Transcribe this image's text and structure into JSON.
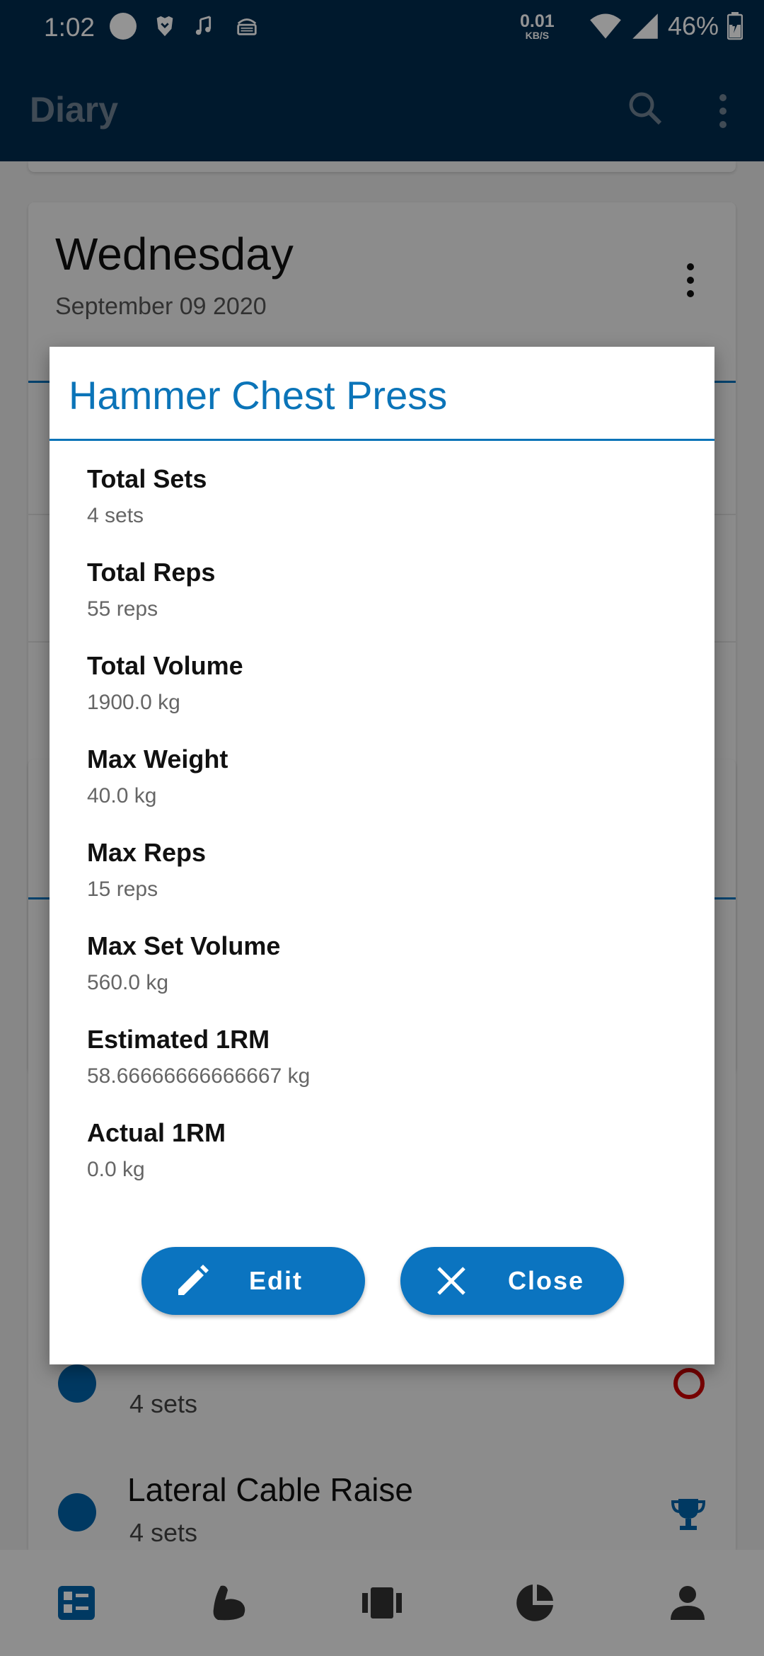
{
  "status_bar": {
    "time": "1:02",
    "net_speed": "0.01",
    "net_unit": "KB/S",
    "battery": "46%"
  },
  "app_bar": {
    "title": "Diary"
  },
  "background": {
    "day_name": "Wednesday",
    "day_date": "September 09 2020",
    "items": [
      {
        "name": "",
        "sets": "4 sets"
      },
      {
        "name": "Lateral Cable Raise",
        "sets": "4 sets"
      }
    ]
  },
  "dialog": {
    "title": "Hammer Chest Press",
    "stats": [
      {
        "label": "Total Sets",
        "value": "4 sets"
      },
      {
        "label": "Total Reps",
        "value": "55 reps"
      },
      {
        "label": "Total Volume",
        "value": "1900.0 kg"
      },
      {
        "label": "Max Weight",
        "value": "40.0 kg"
      },
      {
        "label": "Max Reps",
        "value": "15 reps"
      },
      {
        "label": "Max Set Volume",
        "value": "560.0 kg"
      },
      {
        "label": "Estimated 1RM",
        "value": "58.66666666666667 kg"
      },
      {
        "label": "Actual 1RM",
        "value": "0.0 kg"
      }
    ],
    "edit_label": "Edit",
    "close_label": "Close"
  },
  "colors": {
    "primary_dark": "#002b4e",
    "accent": "#0b74c0",
    "title_blue": "#0b74b8"
  },
  "icons": {
    "app_bar": [
      "search-icon",
      "more-vert-icon"
    ],
    "bottom_nav": [
      "diary-icon",
      "exercises-icon",
      "routines-icon",
      "stats-icon",
      "profile-icon"
    ]
  }
}
